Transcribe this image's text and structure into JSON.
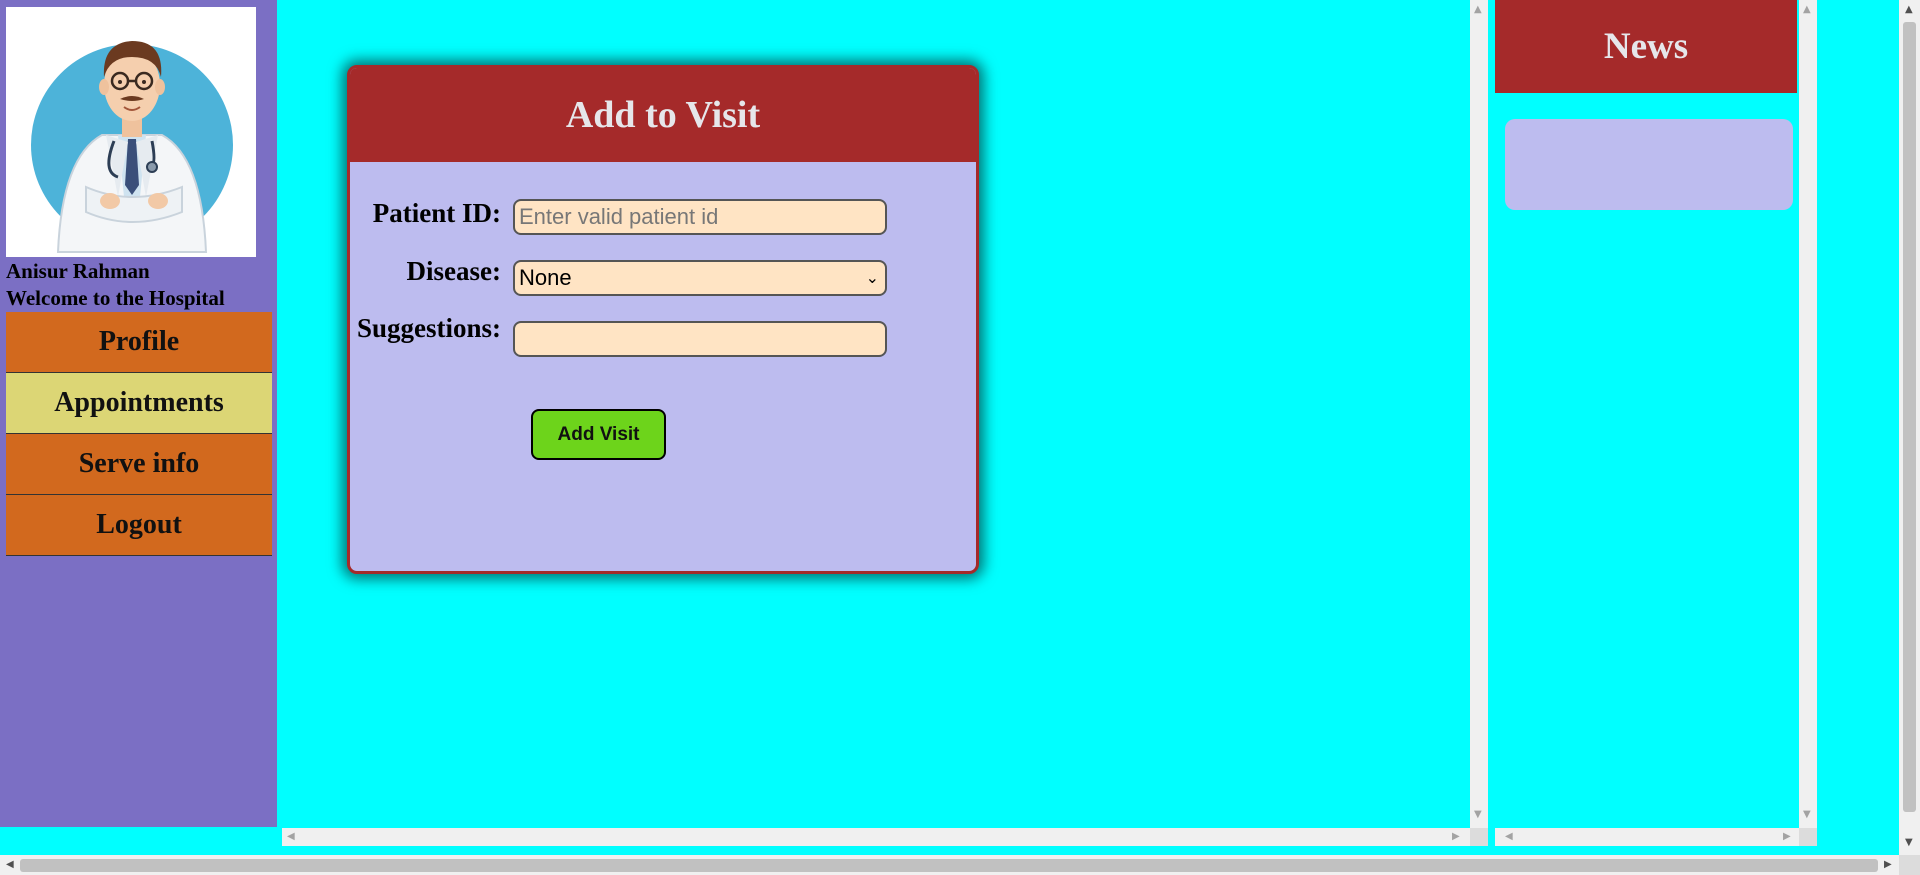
{
  "user": {
    "name": "Anisur Rahman",
    "welcome": "Welcome to the Hospital"
  },
  "nav": {
    "items": [
      {
        "label": "Profile",
        "active": false
      },
      {
        "label": "Appointments",
        "active": true
      },
      {
        "label": "Serve info",
        "active": false
      },
      {
        "label": "Logout",
        "active": false
      }
    ]
  },
  "form": {
    "title": "Add to Visit",
    "patient_id_label": "Patient ID:",
    "patient_id_placeholder": "Enter valid patient id",
    "patient_id_value": "",
    "disease_label": "Disease:",
    "disease_selected": "None",
    "suggestions_label": "Suggestions:",
    "suggestions_value": "",
    "submit_label": "Add Visit"
  },
  "news": {
    "title": "News"
  },
  "colors": {
    "page_bg": "#00ffff",
    "sidebar_bg": "#7b6fc4",
    "nav_item": "#d2691e",
    "nav_active": "#dcd675",
    "header": "#a52a2a",
    "card_bg": "#bdbcef",
    "input_bg": "#ffe4c4",
    "button": "#6dd41b"
  }
}
